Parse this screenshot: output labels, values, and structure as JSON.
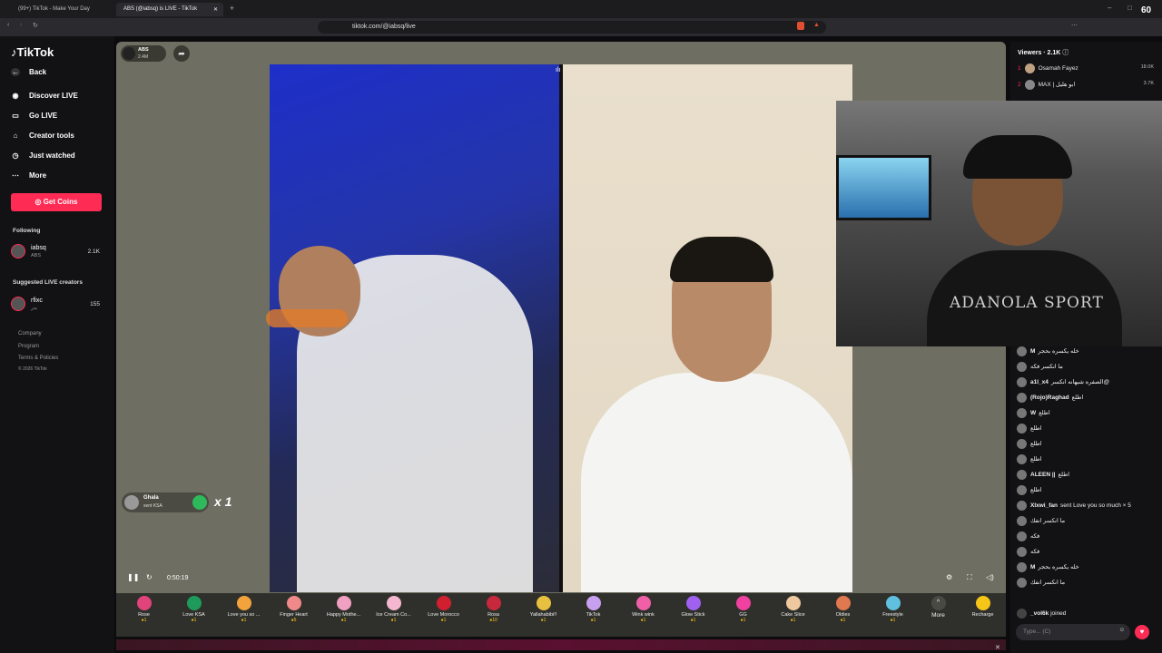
{
  "browser": {
    "tabs": [
      {
        "label": "(99+) TikTok - Make Your Day"
      },
      {
        "label": "ABS (@iabsq) is LIVE - TikTok"
      }
    ],
    "url": "tiktok.com/@iabsq/live",
    "fps": "60"
  },
  "sidebar": {
    "brand": "TikTok",
    "back": "Back",
    "nav": [
      {
        "label": "Discover LIVE",
        "icon": "live-icon"
      },
      {
        "label": "Go LIVE",
        "icon": "camera-icon"
      },
      {
        "label": "Creator tools",
        "icon": "home-icon"
      },
      {
        "label": "Just watched",
        "icon": "history-icon"
      },
      {
        "label": "More",
        "icon": "dots-icon"
      }
    ],
    "get_coins": "Get Coins",
    "following_title": "Following",
    "following": [
      {
        "name": "iabsq",
        "sub": "ABS",
        "count": "2.1K"
      }
    ],
    "suggested_title": "Suggested LIVE creators",
    "suggested": [
      {
        "name": "rfixc",
        "sub": "بدر",
        "count": "155"
      }
    ],
    "footer": [
      "Company",
      "Program",
      "Terms & Policies",
      "© 2026 TikTok"
    ]
  },
  "stream": {
    "host_name": "ABS",
    "host_likes": "2.4M",
    "elapsed": "0:50:19",
    "gift_toast": {
      "user": "Ghala",
      "text": "sent KSA",
      "multiplier": "x 1"
    }
  },
  "gifts": [
    {
      "name": "Rose",
      "price": "1",
      "color": "#e0447a"
    },
    {
      "name": "Love KSA",
      "price": "1",
      "color": "#1e9a5a"
    },
    {
      "name": "Love you so ...",
      "price": "1",
      "color": "#f2a33b"
    },
    {
      "name": "Finger Heart",
      "price": "5",
      "color": "#f08a8a"
    },
    {
      "name": "Happy Mothe...",
      "price": "1",
      "color": "#f0a0c0"
    },
    {
      "name": "Ice Cream Co...",
      "price": "1",
      "color": "#f3b7cf"
    },
    {
      "name": "Love Morocco",
      "price": "1",
      "color": "#d02030"
    },
    {
      "name": "Rosa",
      "price": "10",
      "color": "#c8283c"
    },
    {
      "name": "Yallahabibi!!",
      "price": "1",
      "color": "#e8c040"
    },
    {
      "name": "TikTok",
      "price": "1",
      "color": "#c8a0f0"
    },
    {
      "name": "Wink wink",
      "price": "1",
      "color": "#f060a8"
    },
    {
      "name": "Glow Stick",
      "price": "1",
      "color": "#a060f0"
    },
    {
      "name": "GG",
      "price": "1",
      "color": "#f040a0"
    },
    {
      "name": "Cake Slice",
      "price": "1",
      "color": "#f0c8a0"
    },
    {
      "name": "Oldies",
      "price": "1",
      "color": "#e07850"
    },
    {
      "name": "Freestyle",
      "price": "1",
      "color": "#60c0e0"
    }
  ],
  "gift_more": "More",
  "recharge": "Recharge",
  "viewers": {
    "title": "Viewers · 2.1K",
    "list": [
      {
        "rank": "1",
        "name": "Osamah Fayez",
        "count": "18.0K"
      },
      {
        "rank": "2",
        "name": "MAX | ابو هليل",
        "count": "3.7K"
      }
    ]
  },
  "chat": [
    {
      "user": "M",
      "text": "خله يكسره بحجر"
    },
    {
      "user": "",
      "text": "ما انكسر فكه"
    },
    {
      "user": "a1l_x4",
      "text": "الصفره شيهانه انكسر@"
    },
    {
      "user": "(Rojo)Raghad",
      "text": "اطلع"
    },
    {
      "user": "W",
      "text": "اطلع"
    },
    {
      "user": "",
      "text": "اطلع"
    },
    {
      "user": "",
      "text": "اطلع"
    },
    {
      "user": "",
      "text": "اطلع"
    },
    {
      "user": "ALEEN ||",
      "text": "اطلع"
    },
    {
      "user": "",
      "text": "اطلع"
    },
    {
      "user": "Xlxwi_fan",
      "text": "sent Love you so much × 5"
    },
    {
      "user": "",
      "text": "ما انكسر انفك"
    },
    {
      "user": "",
      "text": "فكه"
    },
    {
      "user": "",
      "text": "فكه"
    },
    {
      "user": "M",
      "text": "خله يكسره بحجر"
    },
    {
      "user": "",
      "text": "ما انكسر انفك"
    }
  ],
  "joined": {
    "user": "_vol6k",
    "text": "joined"
  },
  "chat_placeholder": "Type... (C)"
}
